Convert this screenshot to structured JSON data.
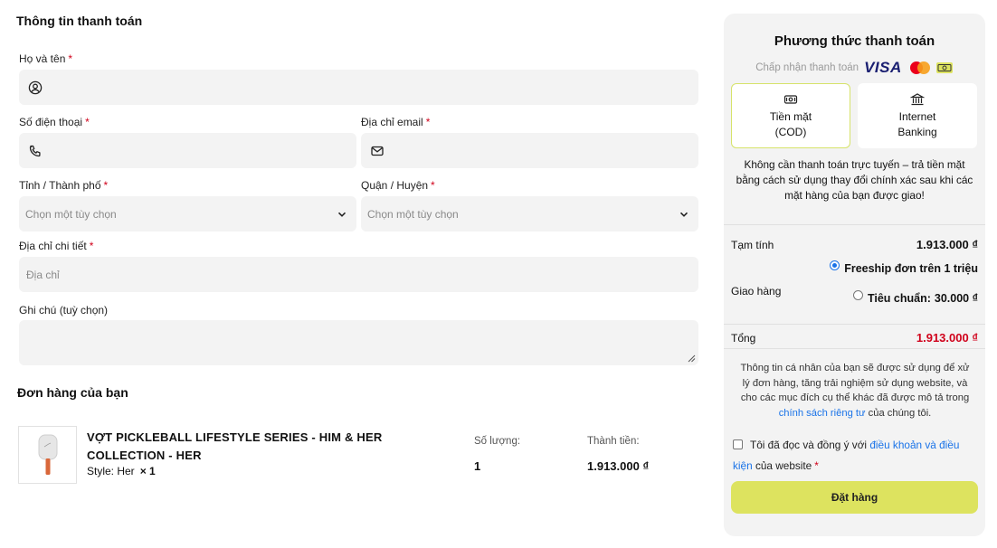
{
  "billing": {
    "title": "Thông tin thanh toán",
    "name_label": "Họ và tên",
    "phone_label": "Số điện thoại",
    "email_label": "Địa chỉ email",
    "city_label": "Tỉnh / Thành phố",
    "district_label": "Quận / Huyện",
    "select_placeholder": "Chọn một tùy chọn",
    "address_label": "Địa chỉ chi tiết",
    "address_placeholder": "Địa chỉ",
    "note_label": "Ghi chú (tuỳ chọn)",
    "required_mark": "*"
  },
  "order": {
    "title": "Đơn hàng của bạn",
    "product_name": "VỢT PICKLEBALL LIFESTYLE SERIES - HIM & HER COLLECTION - HER",
    "product_style": "Style: Her",
    "product_qty_mark": "× 1",
    "qty_header": "Số lượng:",
    "qty_value": "1",
    "total_header": "Thành tiền:",
    "total_value": "1.913.000 ₫"
  },
  "payment": {
    "title": "Phương thức thanh toán",
    "accept_text": "Chấp nhận thanh toán",
    "visa_text": "VISA",
    "methods": [
      {
        "line1": "Tiền mặt",
        "line2": "(COD)",
        "icon": "cash-icon"
      },
      {
        "line1": "Internet",
        "line2": "Banking",
        "icon": "bank-icon"
      }
    ],
    "cod_note": "Không cần thanh toán trực tuyến – trả tiền mặt bằng cách sử dụng thay đổi chính xác sau khi các mặt hàng của bạn được giao!",
    "subtotal_label": "Tạm tính",
    "subtotal_value": "1.913.000 ₫",
    "shipping_label": "Giao hàng",
    "ship_free": "Freeship đơn trên 1 triệu",
    "ship_std_label": "Tiêu chuẩn:",
    "ship_std_value": "30.000 ₫",
    "total_label": "Tổng",
    "total_value": "1.913.000 ₫",
    "privacy_text": "Thông tin cá nhân của bạn sẽ được sử dụng để xử lý đơn hàng, tăng trải nghiệm sử dụng website, và cho các mục đích cụ thể khác đã được mô tả trong",
    "privacy_link": "chính sách riêng tư",
    "privacy_tail": "của chúng tôi.",
    "agree_text": "Tôi đã đọc và đồng ý với",
    "agree_link": "điều khoản và điều kiện",
    "agree_tail": "của website",
    "order_button": "Đặt hàng"
  },
  "colors": {
    "accent": "#dde35f",
    "required": "#d0021b",
    "link": "#1a73e8",
    "panel_bg": "#f3f3f3"
  }
}
